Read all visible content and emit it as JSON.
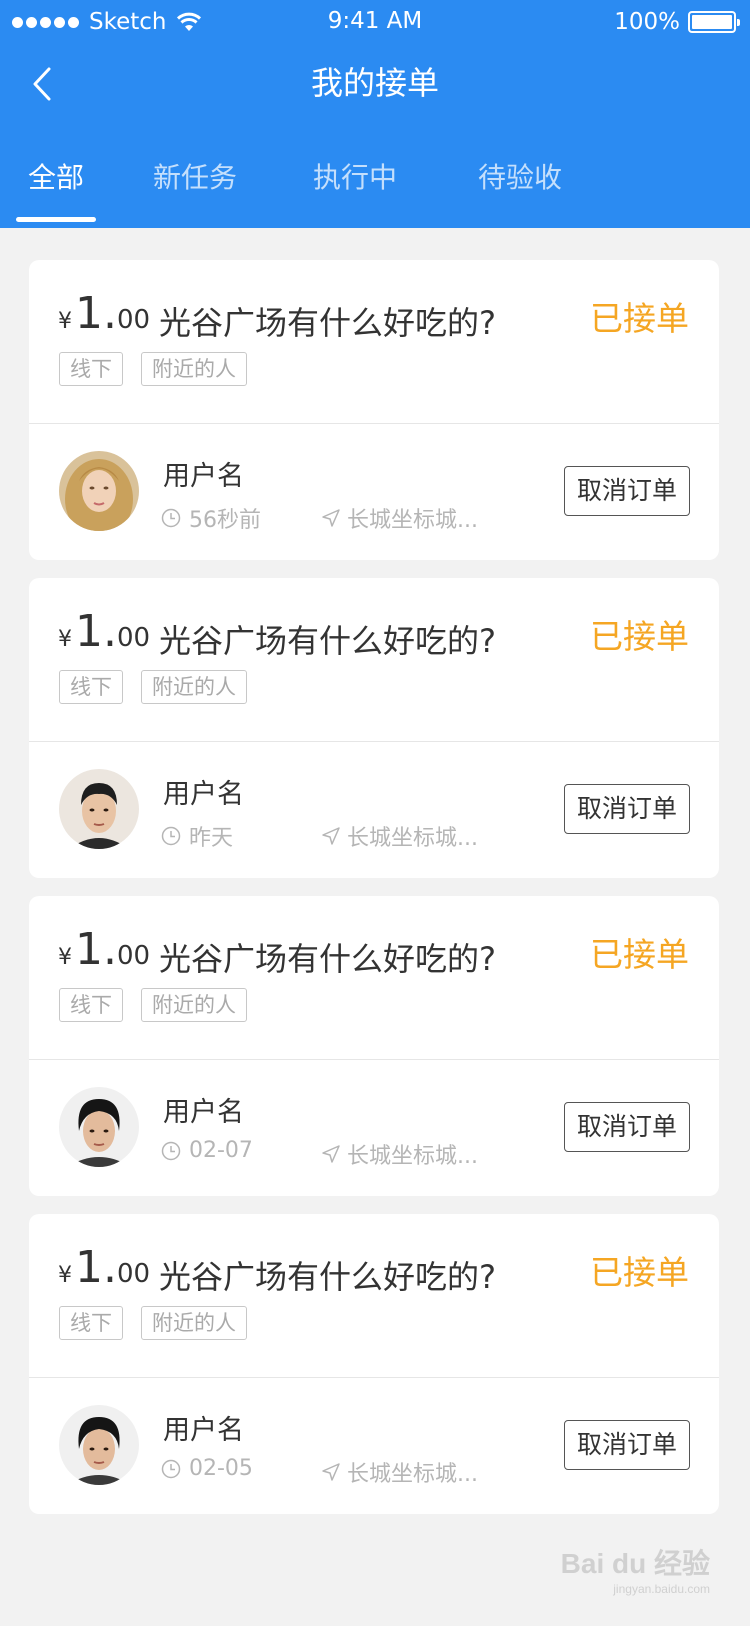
{
  "status_bar": {
    "carrier": "Sketch",
    "time": "9:41 AM",
    "battery": "100%"
  },
  "header": {
    "title": "我的接单"
  },
  "tabs": [
    {
      "label": "全部",
      "active": true
    },
    {
      "label": "新任务",
      "active": false
    },
    {
      "label": "执行中",
      "active": false
    },
    {
      "label": "待验收",
      "active": false
    }
  ],
  "orders": [
    {
      "currency": "¥",
      "price_int": "1.",
      "price_dec": "00",
      "title": "光谷广场有什么好吃的?",
      "status": "已接单",
      "tags": [
        "线下",
        "附近的人"
      ],
      "user": "用户名",
      "time": "56秒前",
      "location": "长城坐标城...",
      "action": "取消订单",
      "avatar": "female-avatar"
    },
    {
      "currency": "¥",
      "price_int": "1.",
      "price_dec": "00",
      "title": "光谷广场有什么好吃的?",
      "status": "已接单",
      "tags": [
        "线下",
        "附近的人"
      ],
      "user": "用户名",
      "time": "昨天",
      "location": "长城坐标城...",
      "action": "取消订单",
      "avatar": "male-avatar"
    },
    {
      "currency": "¥",
      "price_int": "1.",
      "price_dec": "00",
      "title": "光谷广场有什么好吃的?",
      "status": "已接单",
      "tags": [
        "线下",
        "附近的人"
      ],
      "user": "用户名",
      "time": "02-07",
      "location": "长城坐标城...",
      "action": "取消订单",
      "avatar": "male-avatar"
    },
    {
      "currency": "¥",
      "price_int": "1.",
      "price_dec": "00",
      "title": "光谷广场有什么好吃的?",
      "status": "已接单",
      "tags": [
        "线下",
        "附近的人"
      ],
      "user": "用户名",
      "time": "02-05",
      "location": "长城坐标城...",
      "action": "取消订单",
      "avatar": "male-avatar"
    }
  ],
  "watermark": {
    "brand": "Bai du 经验",
    "url": "jingyan.baidu.com"
  },
  "colors": {
    "header": "#2b8bf2",
    "status": "#f5a623",
    "background": "#f2f2f2"
  }
}
